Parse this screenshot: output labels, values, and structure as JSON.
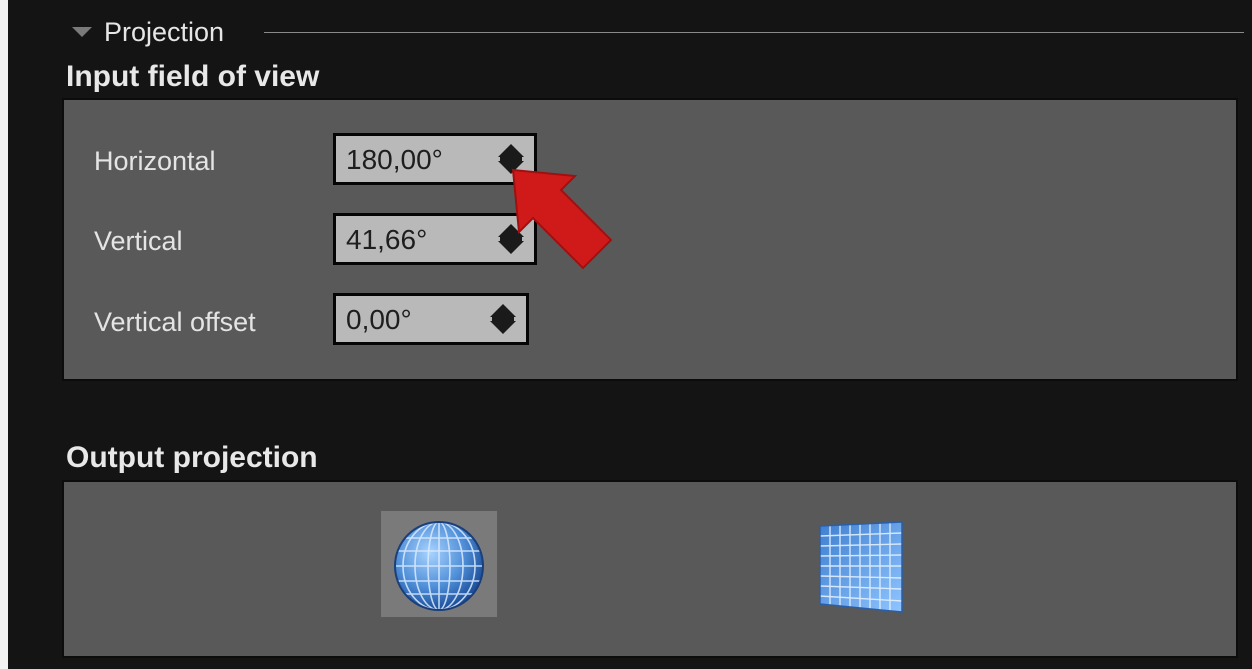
{
  "section": {
    "title": "Projection",
    "collapse_icon": "triangle-down-icon"
  },
  "input_fov": {
    "title": "Input field of view",
    "rows": [
      {
        "label": "Horizontal",
        "value": "180,00°"
      },
      {
        "label": "Vertical",
        "value": "41,66°"
      },
      {
        "label": "Vertical offset",
        "value": "0,00°"
      }
    ]
  },
  "output_projection": {
    "title": "Output projection",
    "options": [
      {
        "icon": "sphere-projection-icon",
        "selected": true
      },
      {
        "icon": "flat-projection-icon",
        "selected": false
      }
    ]
  },
  "annotation": {
    "icon": "red-pointer-arrow",
    "color": "#d01a1a"
  },
  "colors": {
    "panel_bg": "#141414",
    "group_bg": "#595959",
    "field_bg": "#b9b9b9",
    "icon_blue": "#4f8fd8"
  }
}
